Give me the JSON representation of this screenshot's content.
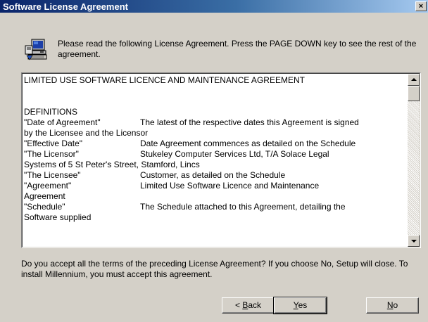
{
  "window": {
    "title": "Software License Agreement",
    "close_glyph": "×"
  },
  "icons": {
    "setup": "setup-computer-icon",
    "close": "close-icon"
  },
  "intro": {
    "text": "Please read the following License Agreement.  Press the PAGE DOWN key to see the rest of the agreement."
  },
  "agreement": {
    "heading": "LIMITED USE SOFTWARE LICENCE AND MAINTENANCE AGREEMENT",
    "section": "DEFINITIONS",
    "definitions": [
      {
        "term": "\"Date of Agreement\"",
        "text": "The latest of the respective dates this Agreement is signed",
        "cont": "by the Licensee and the Licensor"
      },
      {
        "term": "\"Effective Date\"",
        "text": "Date Agreement commences as detailed on the Schedule",
        "cont": ""
      },
      {
        "term": "\"The Licensor\"",
        "text": "Stukeley Computer Services Ltd, T/A Solace Legal",
        "cont": "Systems of 5 St Peter's Street, Stamford, Lincs"
      },
      {
        "term": "\"The Licensee\"",
        "text": "Customer, as detailed on the Schedule",
        "cont": ""
      },
      {
        "term": "\"Agreement\"",
        "text": "Limited Use Software Licence and Maintenance",
        "cont": "Agreement"
      },
      {
        "term": "\"Schedule\"",
        "text": "The Schedule attached to this Agreement, detailing the",
        "cont": "Software supplied"
      }
    ]
  },
  "question": {
    "text": "Do you accept all the terms of the preceding License Agreement?  If you choose No,  Setup will close.  To install Millennium, you must accept this agreement."
  },
  "buttons": {
    "back": {
      "prefix": "< ",
      "mnemonic": "B",
      "rest": "ack"
    },
    "yes": {
      "prefix": "",
      "mnemonic": "Y",
      "rest": "es"
    },
    "no": {
      "prefix": "",
      "mnemonic": "N",
      "rest": "o"
    }
  }
}
